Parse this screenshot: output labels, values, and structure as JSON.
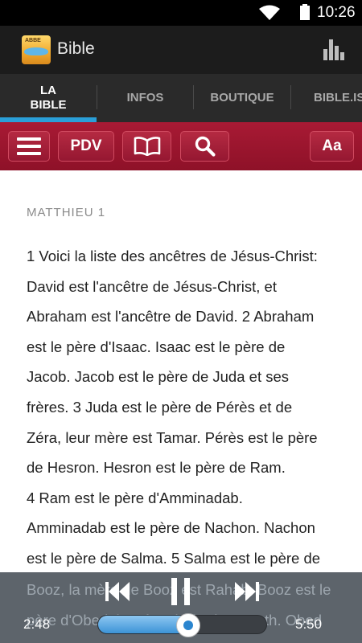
{
  "status_bar": {
    "time": "10:26"
  },
  "app": {
    "title": "Bible",
    "logo_text": "ABBE"
  },
  "tabs": [
    {
      "label": "LA\nBIBLE",
      "active": true
    },
    {
      "label": "INFOS",
      "active": false
    },
    {
      "label": "BOUTIQUE",
      "active": false
    },
    {
      "label": "BIBLE.IS",
      "active": false
    }
  ],
  "toolbar": {
    "version_label": "PDV",
    "font_label": "Aa"
  },
  "reader": {
    "chapter": "MATTHIEU 1",
    "lines": [
      " 1 Voici la liste des ancêtres de Jésus-Christ:",
      "David est l'ancêtre de Jésus-Christ, et",
      "Abraham est l'ancêtre de David.    2 Abraham",
      "est le père d'Isaac. Isaac est le père de",
      "Jacob. Jacob est le père de Juda et ses",
      "frères.    3 Juda est le père de Pérès et de",
      "Zéra, leur mère est Tamar. Pérès est le père",
      "de Hesron. Hesron est le père de Ram.",
      " 4 Ram est le père d'Amminadab.",
      "Amminadab est le père de Nachon. Nachon",
      "est le père de Salma.    5 Salma est le père de"
    ],
    "faded_lines": [
      "Booz, la mère de Booz est Rahab. Booz est le",
      "père d'Obed, la mère d'Obed est Ruth. Obed"
    ]
  },
  "player": {
    "elapsed": "2:48",
    "duration": "5:50",
    "progress": 0.48
  },
  "colors": {
    "accent_blue": "#2a9fd8",
    "toolbar_red": "#a81a34"
  }
}
